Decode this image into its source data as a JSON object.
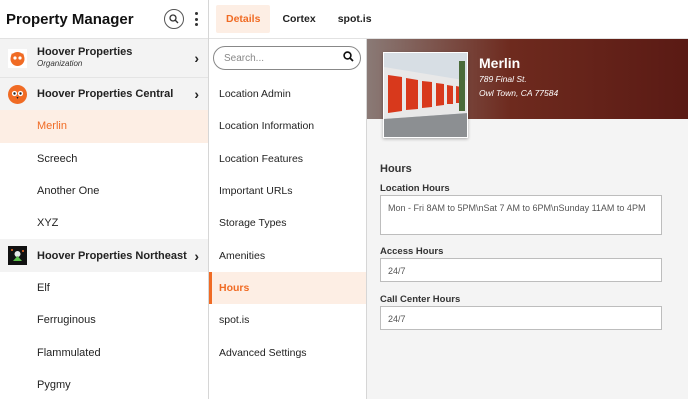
{
  "app": {
    "title": "Property Manager"
  },
  "colors": {
    "accent": "#f06b24",
    "active_bg": "#fdeee4",
    "hero_dark": "#5a1a14"
  },
  "icons": {
    "search": "search-icon",
    "menu": "kebab-menu-icon",
    "chevron": "chevron-right-icon"
  },
  "tabs": [
    {
      "label": "Details",
      "active": true
    },
    {
      "label": "Cortex",
      "active": false
    },
    {
      "label": "spot.is",
      "active": false
    }
  ],
  "tree": {
    "org": {
      "name": "Hoover Properties",
      "type": "Organization",
      "chevron": "›"
    },
    "groups": [
      {
        "name": "Hoover Properties Central",
        "chevron": "›",
        "locations": [
          "Merlin",
          "Screech",
          "Another One",
          "XYZ"
        ]
      },
      {
        "name": "Hoover Properties Northeast",
        "chevron": "›",
        "locations": [
          "Elf",
          "Ferruginous",
          "Flammulated",
          "Pygmy"
        ]
      }
    ],
    "active_location": "Merlin"
  },
  "search": {
    "placeholder": "Search..."
  },
  "menu": [
    "Location Admin",
    "Location Information",
    "Location Features",
    "Important URLs",
    "Storage Types",
    "Amenities",
    "Hours",
    "spot.is",
    "Advanced Settings"
  ],
  "menu_active": "Hours",
  "location": {
    "name": "Merlin",
    "address_line1": "789 Final St.",
    "address_line2": "Owl Town, CA 77584"
  },
  "hours": {
    "section_title": "Hours",
    "location_hours_label": "Location Hours",
    "location_hours_value": "Mon - Fri 8AM to 5PM\\nSat 7 AM to 6PM\\nSunday 11AM to 4PM",
    "access_hours_label": "Access Hours",
    "access_hours_value": "24/7",
    "call_center_label": "Call Center Hours",
    "call_center_value": "24/7"
  }
}
